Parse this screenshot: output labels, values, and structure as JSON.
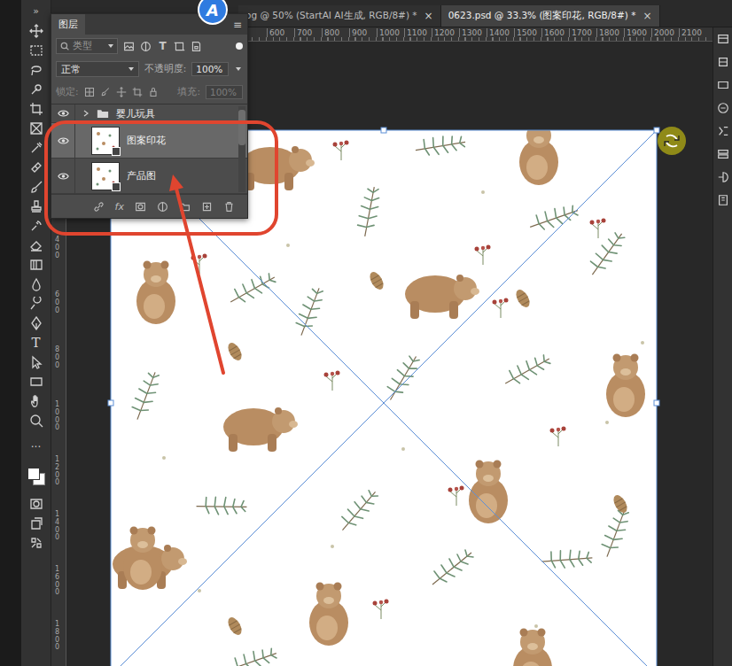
{
  "window": {
    "collapse": "»",
    "logo": "A",
    "tabs": [
      {
        "label": "og @ 50% (StartAI AI生成, RGB/8#) *",
        "close": "×",
        "selected": false
      },
      {
        "label": "0623.psd @ 33.3% (图案印花, RGB/8#) *",
        "close": "×",
        "selected": true
      }
    ]
  },
  "toolbar": {
    "type_tool": "T",
    "more": "···"
  },
  "rulers": {
    "horizontal": [
      "600",
      "700",
      "800",
      "900",
      "1000",
      "1100",
      "1200",
      "1300",
      "1400",
      "1500",
      "1600",
      "1700",
      "1800",
      "1900",
      "2000",
      "2100"
    ],
    "vertical": [
      "400",
      "600",
      "800",
      "1000",
      "1200",
      "1400",
      "1600",
      "1800"
    ]
  },
  "layers_panel": {
    "title": "图层",
    "menu": "≡",
    "filter": {
      "placeholder": "类型",
      "type_glyph": "T",
      "enabled": true
    },
    "blend_mode": "正常",
    "opacity_label": "不透明度:",
    "opacity": "100%",
    "lock_label": "锁定:",
    "fill_label": "填充:",
    "fill": "100%",
    "fill_disabled": true,
    "layers": [
      {
        "name": "婴儿玩具",
        "kind": "group",
        "visible": true,
        "selected": false
      },
      {
        "name": "图案印花",
        "kind": "smart",
        "visible": true,
        "selected": true
      },
      {
        "name": "产品图",
        "kind": "smart",
        "visible": true,
        "selected": false
      }
    ],
    "footer": {
      "fx": "fx"
    }
  },
  "canvas": {
    "transform_active": true
  }
}
